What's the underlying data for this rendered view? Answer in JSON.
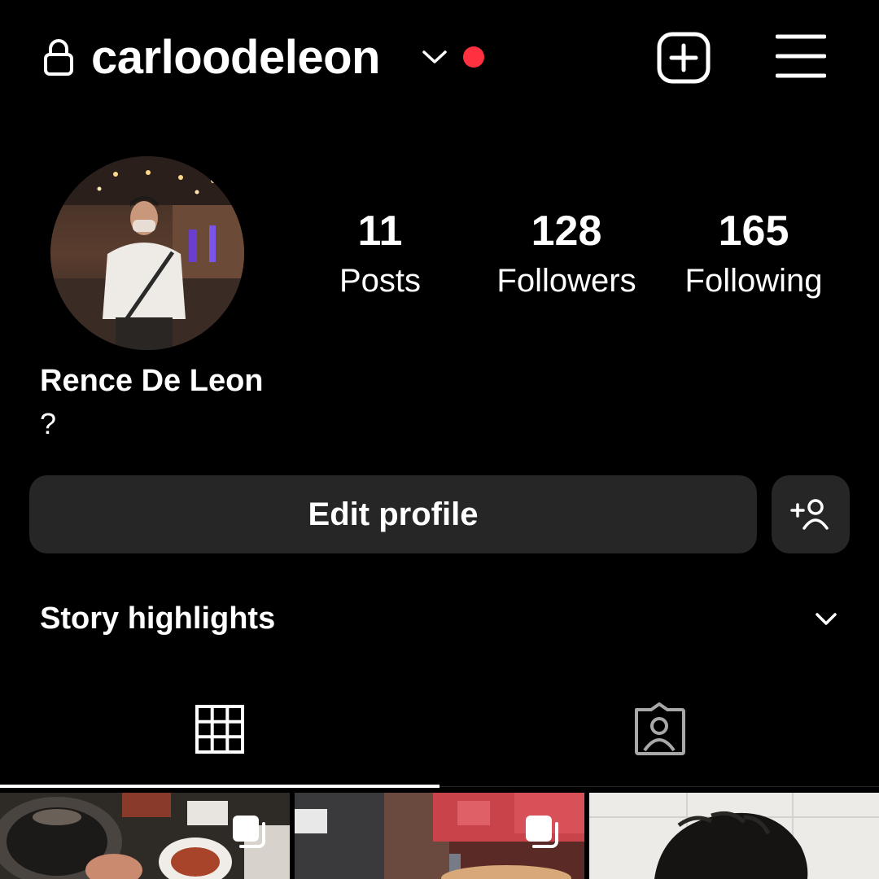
{
  "header": {
    "username": "carloodeleon",
    "lock_icon": "lock-icon",
    "account_switch_icon": "chevron-down-icon",
    "notification_dot_color": "#ff3040",
    "new_post_icon": "plus-square-icon",
    "menu_icon": "hamburger-menu-icon"
  },
  "profile": {
    "full_name": "Rence De Leon",
    "bio": "?",
    "stats": [
      {
        "value": "11",
        "label": "Posts"
      },
      {
        "value": "128",
        "label": "Followers"
      },
      {
        "value": "165",
        "label": "Following"
      }
    ]
  },
  "actions": {
    "edit_profile_label": "Edit profile",
    "discover_people_icon": "add-person-icon"
  },
  "highlights": {
    "title": "Story highlights",
    "toggle_icon": "chevron-down-icon"
  },
  "tabs": [
    {
      "name": "posts",
      "icon": "grid-icon",
      "active": true
    },
    {
      "name": "tagged",
      "icon": "tagged-person-icon",
      "active": false
    }
  ],
  "posts": [
    {
      "type": "carousel",
      "icon": "multiple-photos-icon"
    },
    {
      "type": "carousel",
      "icon": "multiple-photos-icon"
    },
    {
      "type": "photo"
    }
  ],
  "colors": {
    "background": "#000000",
    "button_bg": "#262626",
    "text": "#ffffff",
    "accent_dot": "#ff3040"
  }
}
